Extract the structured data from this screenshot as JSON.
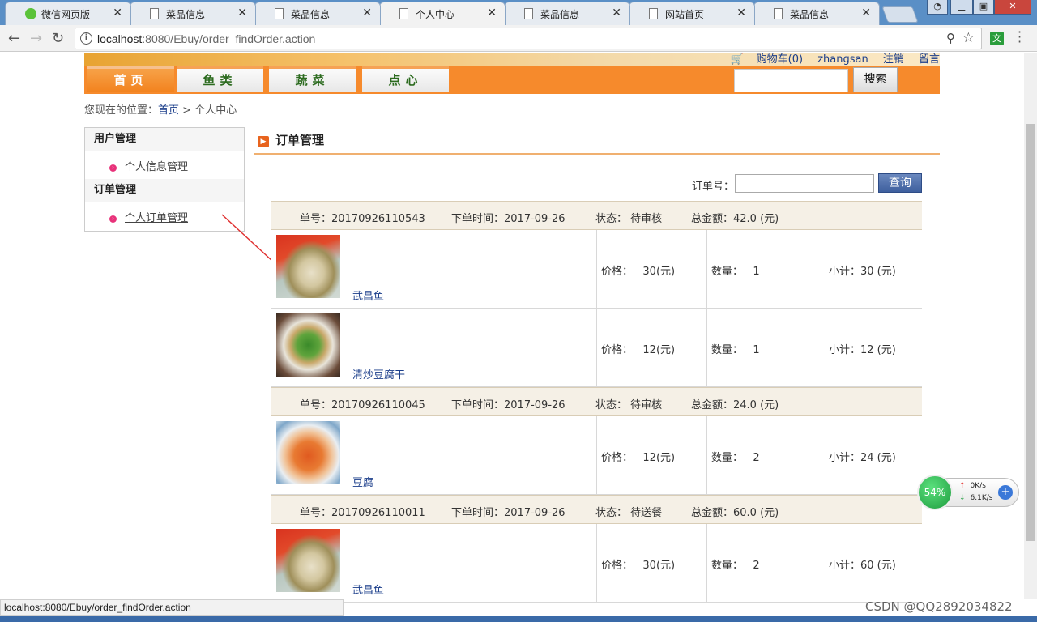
{
  "browser": {
    "tabs": [
      {
        "title": "微信网页版",
        "icon": "wechat-icon",
        "active": false
      },
      {
        "title": "菜品信息",
        "icon": "page-icon",
        "active": false
      },
      {
        "title": "菜品信息",
        "icon": "page-icon",
        "active": false
      },
      {
        "title": "个人中心",
        "icon": "page-icon",
        "active": true
      },
      {
        "title": "菜品信息",
        "icon": "page-icon",
        "active": false
      },
      {
        "title": "网站首页",
        "icon": "page-icon",
        "active": false
      },
      {
        "title": "菜品信息",
        "icon": "page-icon",
        "active": false
      }
    ],
    "url_host": "localhost",
    "url_rest": ":8080/Ebuy/order_findOrder.action",
    "ext_label": "文",
    "status_url": "localhost:8080/Ebuy/order_findOrder.action"
  },
  "site": {
    "top_links": {
      "cart": "购物车(0)",
      "user": "zhangsan",
      "logout": "注销",
      "message": "留言"
    },
    "nav": [
      {
        "label": "首页",
        "active": true
      },
      {
        "label": "鱼类",
        "active": false
      },
      {
        "label": "蔬菜",
        "active": false
      },
      {
        "label": "点心",
        "active": false
      }
    ],
    "search_btn": "搜索",
    "breadcrumb": {
      "prefix": "您现在的位置：",
      "home": "首页",
      "sep": " > ",
      "current": "个人中心"
    }
  },
  "sidebar": {
    "groups": [
      {
        "heading": "用户管理",
        "items": [
          {
            "label": "个人信息管理",
            "selected": false
          }
        ]
      },
      {
        "heading": "订单管理",
        "items": [
          {
            "label": "个人订单管理",
            "selected": true
          }
        ]
      }
    ]
  },
  "main": {
    "title": "订单管理",
    "query_label": "订单号：",
    "query_btn": "查询",
    "orders": [
      {
        "no": "单号：20170926110543",
        "time": "下单时间：2017-09-26",
        "status": "状态： 待审核",
        "total": "总金额：42.0 (元)",
        "items": [
          {
            "name": "武昌鱼",
            "img": "fish",
            "price": "价格：   30(元)",
            "qty": "数量：   1",
            "subtotal": "小计：30 (元)"
          },
          {
            "name": "清炒豆腐干",
            "img": "tofu-dry",
            "price": "价格：   12(元)",
            "qty": "数量：   1",
            "subtotal": "小计：12 (元)"
          }
        ]
      },
      {
        "no": "单号：20170926110045",
        "time": "下单时间：2017-09-26",
        "status": "状态： 待审核",
        "total": "总金额：24.0 (元)",
        "items": [
          {
            "name": "豆腐",
            "img": "tofu",
            "price": "价格：   12(元)",
            "qty": "数量：   2",
            "subtotal": "小计：24 (元)"
          }
        ]
      },
      {
        "no": "单号：20170926110011",
        "time": "下单时间：2017-09-26",
        "status": "状态： 待送餐",
        "total": "总金额：60.0 (元)",
        "items": [
          {
            "name": "武昌鱼",
            "img": "fish",
            "price": "价格：   30(元)",
            "qty": "数量：   2",
            "subtotal": "小计：60 (元)"
          }
        ]
      }
    ]
  },
  "overlay": {
    "watermark": "CSDN @QQ2892034822",
    "speed_percent": "54%",
    "upload": "0K/s",
    "download": "6.1K/s"
  }
}
